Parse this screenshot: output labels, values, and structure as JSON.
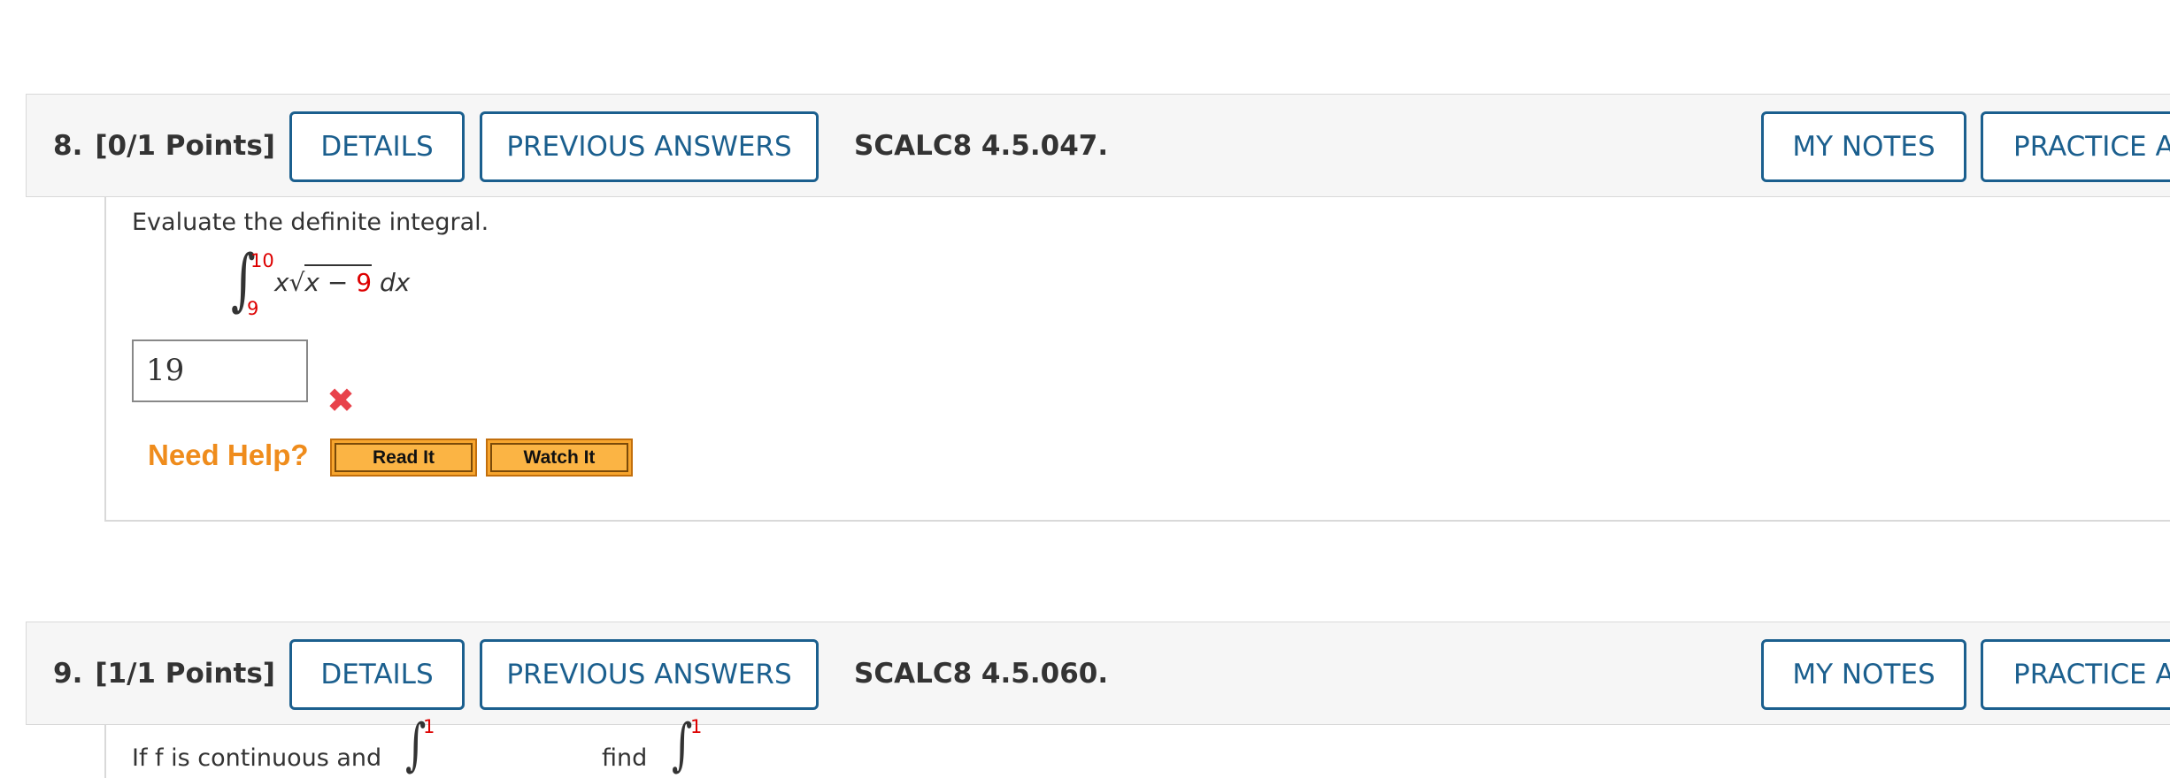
{
  "question8": {
    "number": "8.",
    "points": "[0/1 Points]",
    "details_label": "DETAILS",
    "previous_answers_label": "PREVIOUS ANSWERS",
    "code": "SCALC8 4.5.047.",
    "my_notes_label": "MY NOTES",
    "practice_label": "PRACTICE A",
    "prompt": "Evaluate the definite integral.",
    "integral": {
      "upper_limit": "10",
      "lower_limit": "9",
      "integrand_prefix": "x",
      "radicand_var": "x",
      "radicand_op": "−",
      "radicand_const": "9",
      "differential": "dx"
    },
    "answer_value": "19",
    "answer_status_icon": "wrong-x-icon",
    "need_help_label": "Need Help?",
    "read_it_label": "Read It",
    "watch_it_label": "Watch It"
  },
  "question9": {
    "number": "9.",
    "points": "[1/1 Points]",
    "details_label": "DETAILS",
    "previous_answers_label": "PREVIOUS ANSWERS",
    "code": "SCALC8 4.5.060.",
    "my_notes_label": "MY NOTES",
    "practice_label": "PRACTICE A",
    "prompt_start": "If f is continuous and",
    "prompt_find": "find",
    "upper_limit_1": "1",
    "upper_limit_2": "1"
  },
  "colors": {
    "accent_blue": "#1b5f8e",
    "error_red": "#e8424b",
    "limit_red": "#dd0000",
    "help_orange": "#ef8c1c",
    "button_orange": "#f7a52e"
  }
}
